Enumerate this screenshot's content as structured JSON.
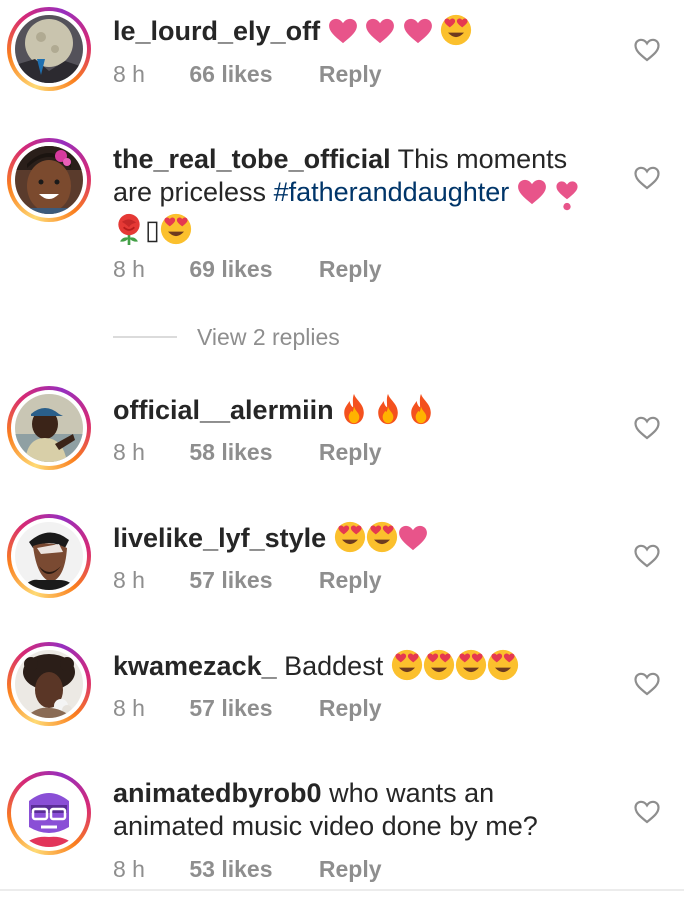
{
  "comments": [
    {
      "username": "le_lourd_ely_off",
      "text": "",
      "emojis": [
        "heart",
        "heart",
        "heart",
        "heart-eyes"
      ],
      "time": "8 h",
      "likes": "66 likes",
      "reply": "Reply",
      "avatar_icon": "full-moon-avatar"
    },
    {
      "username": "the_real_tobe_official",
      "text_before": " This moments are priceless ",
      "hashtag": "#fatheranddaughter",
      "emojis_line1": [
        "heart",
        "heart-exclamation"
      ],
      "emojis_line2": [
        "rose",
        "missing-glyph",
        "heart-eyes"
      ],
      "missing_glyph": "▯",
      "time": "8 h",
      "likes": "69 likes",
      "reply": "Reply",
      "avatar_icon": "smiling-man-avatar"
    },
    {
      "username": "official__alermiin",
      "emojis": [
        "fire",
        "fire",
        "fire"
      ],
      "time": "8 h",
      "likes": "58 likes",
      "reply": "Reply",
      "avatar_icon": "man-in-cap-avatar"
    },
    {
      "username": "livelike_lyf_style",
      "emojis": [
        "heart-eyes",
        "heart-eyes",
        "heart"
      ],
      "time": "8 h",
      "likes": "57 likes",
      "reply": "Reply",
      "avatar_icon": "illustrated-man-avatar"
    },
    {
      "username": "kwamezack_",
      "text": " Baddest ",
      "emojis": [
        "heart-eyes",
        "heart-eyes",
        "heart-eyes",
        "heart-eyes"
      ],
      "time": "8 h",
      "likes": "57 likes",
      "reply": "Reply",
      "avatar_icon": "curly-hair-man-avatar"
    },
    {
      "username": "animatedbyrob0",
      "text": " who wants an animated music video done by me?",
      "time": "8 h",
      "likes": "53 likes",
      "reply": "Reply",
      "avatar_icon": "cartoon-purple-avatar"
    }
  ],
  "view_replies": "View 2 replies",
  "colors": {
    "text": "#262626",
    "meta": "#8e8e8e",
    "hashtag": "#003569",
    "emoji_heart": "#e8548a",
    "emoji_face": "#fbc02d"
  }
}
